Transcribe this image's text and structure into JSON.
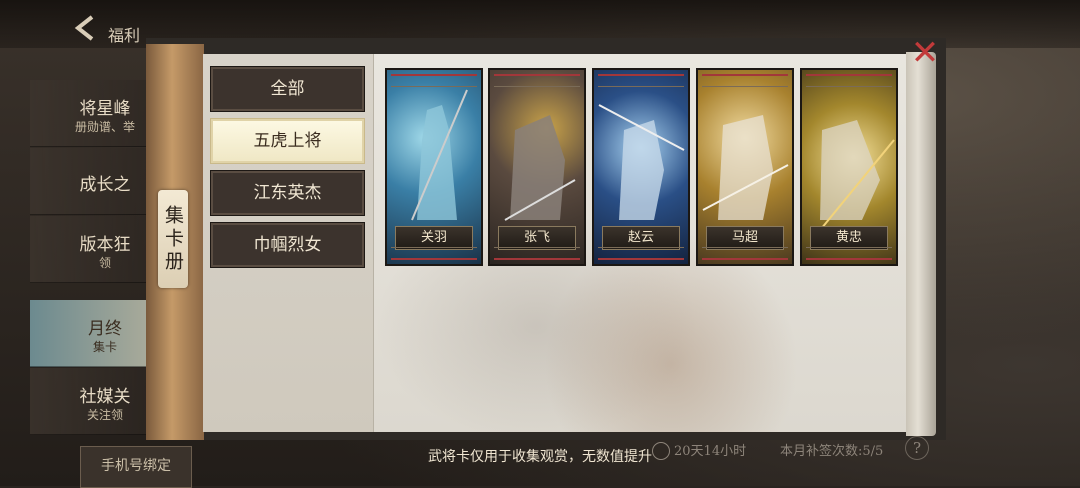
{
  "header": {
    "title": "福利"
  },
  "sidebar": {
    "items": [
      {
        "title": "将星峰",
        "subtitle": "册勋谱、举"
      },
      {
        "title": "成长之",
        "subtitle": ""
      },
      {
        "title": "版本狂",
        "subtitle": "领"
      },
      {
        "title": "月终",
        "subtitle": "集卡"
      },
      {
        "title": "社媒关",
        "subtitle": "关注领"
      }
    ],
    "bottom_button": "手机号绑定"
  },
  "album": {
    "spine_label": "集卡册",
    "categories": [
      "全部",
      "五虎上将",
      "江东英杰",
      "巾帼烈女"
    ],
    "active_category": "五虎上将",
    "cards": [
      {
        "name": "关羽",
        "color": "#3a7fa6"
      },
      {
        "name": "张飞",
        "color": "#5a4a3f"
      },
      {
        "name": "赵云",
        "color": "#2a4f86"
      },
      {
        "name": "马超",
        "color": "#a8812e"
      },
      {
        "name": "黄忠",
        "color": "#a3872d"
      }
    ]
  },
  "footer": {
    "note": "武将卡仅用于收集观赏，无数值提升",
    "timer": "20天14小时",
    "signin": "本月补签次数:5/5",
    "help": "?"
  }
}
